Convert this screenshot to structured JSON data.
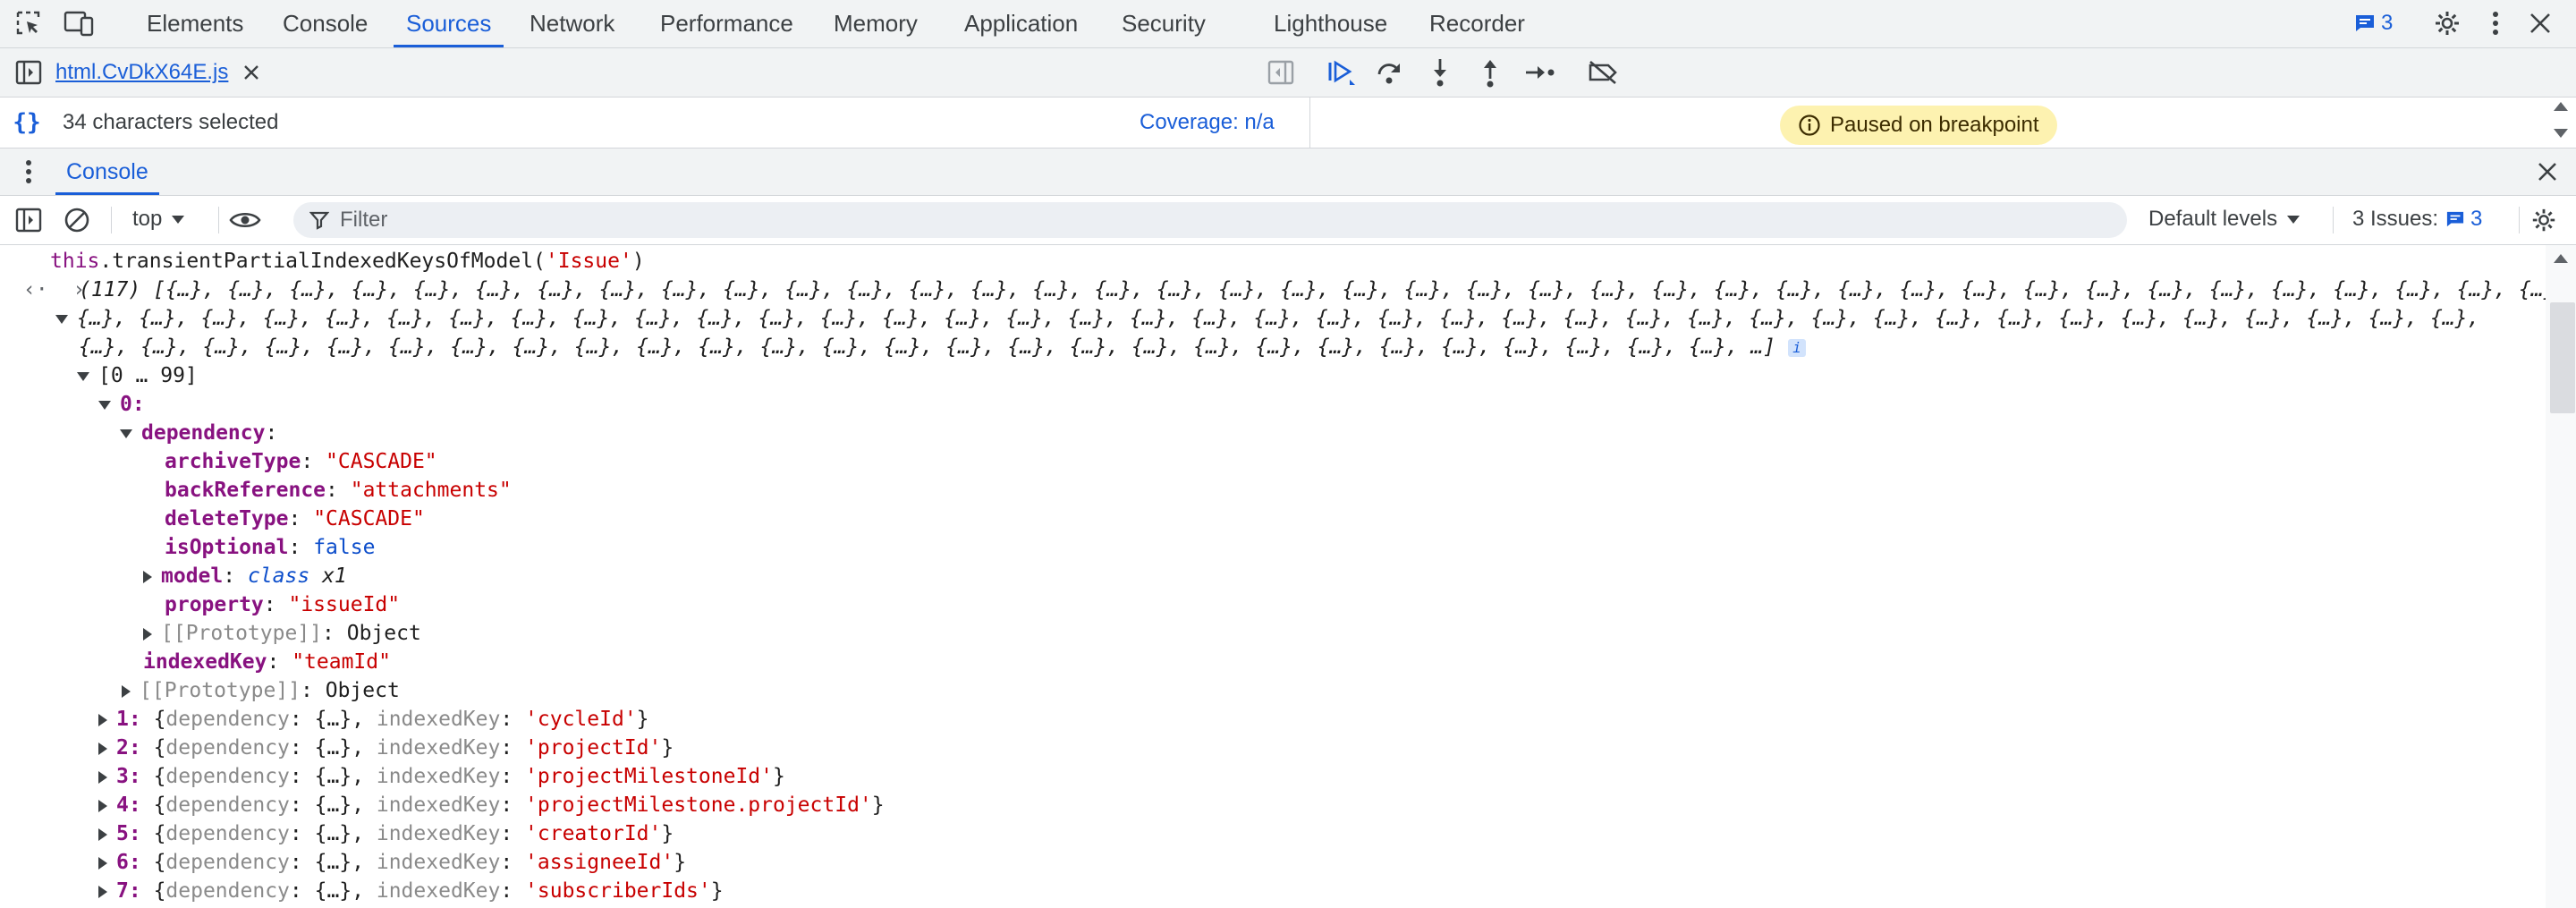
{
  "topbar": {
    "tabs": [
      {
        "label": "Elements"
      },
      {
        "label": "Console"
      },
      {
        "label": "Sources"
      },
      {
        "label": "Network"
      },
      {
        "label": "Performance"
      },
      {
        "label": "Memory"
      },
      {
        "label": "Application"
      },
      {
        "label": "Security"
      },
      {
        "label": "Lighthouse"
      },
      {
        "label": "Recorder"
      }
    ],
    "active_tab": "Sources",
    "issues_count": "3",
    "accent_color": "#1a5ed8"
  },
  "sources": {
    "file_tab": "html.CvDkX64E.js",
    "selection_status": "34 characters selected",
    "coverage": "Coverage: n/a",
    "paused_label": "Paused on breakpoint"
  },
  "drawer": {
    "tab": "Console"
  },
  "console_toolbar": {
    "context": "top",
    "filter_placeholder": "Filter",
    "levels": "Default levels",
    "issues_label": "3 Issues:",
    "issues_count": "3"
  },
  "console": {
    "command": "this.transientPartialIndexedKeysOfModel('Issue')",
    "result_count": "(117)",
    "preview_line1": "[{…}, {…}, {…}, {…}, {…}, {…}, {…}, {…}, {…}, {…}, {…}, {…}, {…}, {…}, {…}, {…}, {…}, {…}, {…}, {…}, {…}, {…}, {…}, {…}, {…}, {…}, {…}, {…}, {…}, {…}, {…}, {…}, {…}, {…}, {…}, {…}, {…}, {…}, {…}, {…},",
    "preview_line2": "{…}, {…}, {…}, {…}, {…}, {…}, {…}, {…}, {…}, {…}, {…}, {…}, {…}, {…}, {…}, {…}, {…}, {…}, {…}, {…}, {…}, {…}, {…}, {…}, {…}, {…}, {…}, {…}, {…}, {…}, {…}, {…}, {…}, {…}, {…}, {…}, {…}, {…}, {…},",
    "preview_line3": "{…}, {…}, {…}, {…}, {…}, {…}, {…}, {…}, {…}, {…}, {…}, {…}, {…}, {…}, {…}, {…}, {…}, {…}, {…}, {…}, {…}, {…}, {…}, {…}, {…}, {…}, {…}, …]",
    "range": "[0 … 99]",
    "item0_key": "0",
    "dependency_key": "dependency",
    "props": [
      {
        "key": "archiveType",
        "value": "\"CASCADE\"",
        "kind": "str"
      },
      {
        "key": "backReference",
        "value": "\"attachments\"",
        "kind": "str"
      },
      {
        "key": "deleteType",
        "value": "\"CASCADE\"",
        "kind": "str"
      },
      {
        "key": "isOptional",
        "value": "false",
        "kind": "kw"
      }
    ],
    "model_key": "model",
    "model_class": "class",
    "model_value": "x1",
    "property_key": "property",
    "property_value": "\"issueId\"",
    "proto_key": "[[Prototype]]",
    "proto_value": "Object",
    "indexedKey_key": "indexedKey",
    "indexedKey_value": "\"teamId\"",
    "items": [
      {
        "index": "1",
        "value": "'cycleId'"
      },
      {
        "index": "2",
        "value": "'projectId'"
      },
      {
        "index": "3",
        "value": "'projectMilestoneId'"
      },
      {
        "index": "4",
        "value": "'projectMilestone.projectId'"
      },
      {
        "index": "5",
        "value": "'creatorId'"
      },
      {
        "index": "6",
        "value": "'assigneeId'"
      },
      {
        "index": "7",
        "value": "'subscriberIds'"
      }
    ],
    "item_dep_label": "dependency",
    "item_dep_value": "{…}",
    "item_idx_label": "indexedKey"
  }
}
